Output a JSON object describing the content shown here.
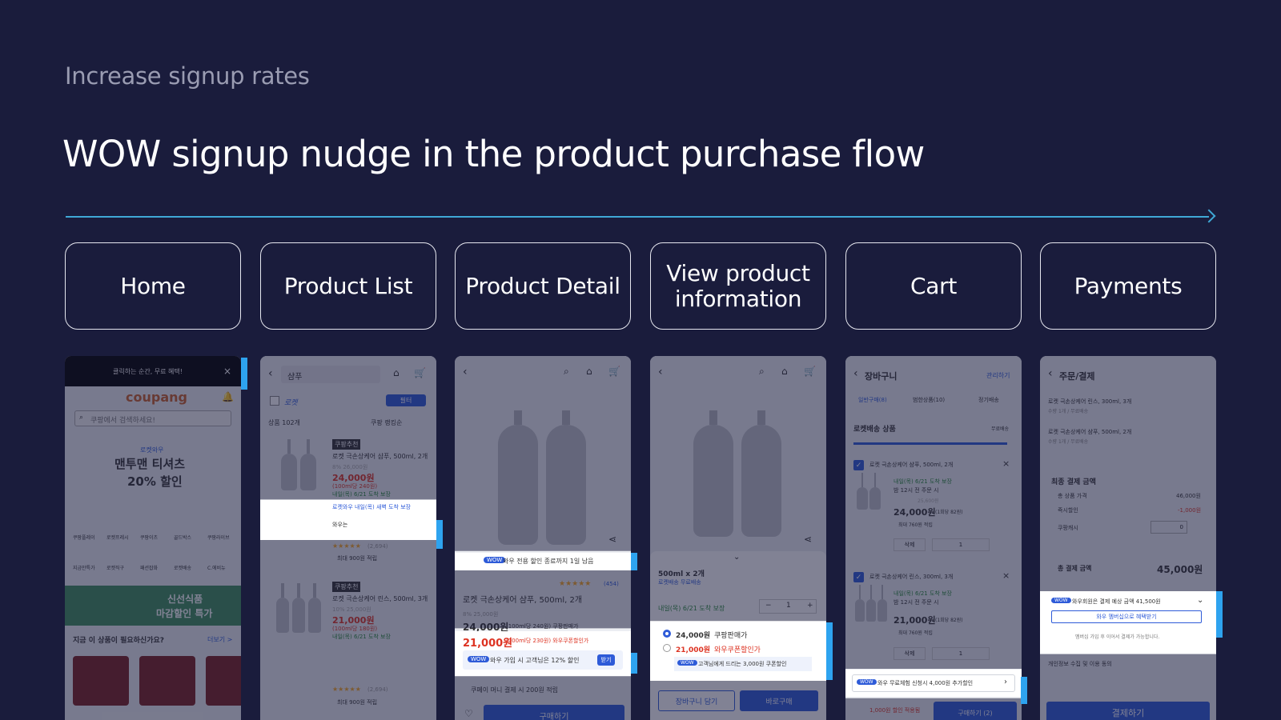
{
  "header": {
    "subtitle": "Increase signup rates",
    "title": "WOW signup nudge in the product purchase flow"
  },
  "colors": {
    "background": "#1a1c3c",
    "accent": "#3fa8d6",
    "highlight_bar": "#2ea3ef",
    "primary_button": "#2e5bd8"
  },
  "steps": [
    {
      "label": "Home"
    },
    {
      "label": "Product List"
    },
    {
      "label": "Product Detail"
    },
    {
      "label": "View product information"
    },
    {
      "label": "Cart"
    },
    {
      "label": "Payments"
    }
  ],
  "screens": {
    "home": {
      "top_banner": "클릭하는 순간, 무료 혜택!",
      "logo": "coupang",
      "search_placeholder": "쿠팡에서 검색하세요!",
      "promo_badge": "로켓와우",
      "promo_line1": "맨투맨 티셔츠",
      "promo_line2": "20% 할인",
      "categories": [
        "쿠팡플레이",
        "로켓프레시",
        "쿠팡이츠",
        "골드박스",
        "쿠팡라이브",
        "지금만특가",
        "로켓직구",
        "패션잡화",
        "로켓배송",
        "C.에비뉴"
      ],
      "fresh_banner1": "신선식품",
      "fresh_banner2": "마감할인 특가",
      "rec_title": "지금 이 상품이 필요하신가요?",
      "rec_more": "더보기 >"
    },
    "product_list": {
      "search_value": "샴푸",
      "filter_rocket": "로켓",
      "filter_button": "필터",
      "count": "상품 102개",
      "sort": "쿠팡 랭킹순",
      "item1_badge": "쿠팡추천",
      "item1_name": "로켓 극손상케어 샴푸, 500ml, 2개",
      "item1_orig": "8% 26,000원",
      "item1_price": "24,000원",
      "item1_unit": "(100ml당 240원)",
      "item1_delivery": "내일(목) 6/21 도착 보장",
      "item1_wow": "로켓와우 내일(목) 새벽 도착 보장",
      "item1_wow_sub": "와우는",
      "item1_rating": "(2,694)",
      "item1_reward": "최대 900원 적립",
      "item2_badge": "쿠팡추천",
      "item2_name": "로켓 극손상케어 린스, 500ml, 3개",
      "item2_orig": "10% 25,000원",
      "item2_price": "21,000원",
      "item2_unit": "(100ml당 180원)",
      "item2_delivery": "내일(목) 6/21 도착 보장",
      "item2_rating": "(2,694)",
      "item2_reward": "최대 900원 적립"
    },
    "product_detail": {
      "wow_strip": "와우 전용 할인 종료까지 1일 남음",
      "rating": "(454)",
      "name": "로켓 극손상케어 샴푸, 500ml, 2개",
      "orig": "8% 25,000원",
      "price": "24,000원",
      "price_note": "(100ml당 240원) 쿠팡판매가",
      "wow_price": "21,000원",
      "wow_price_note": "(100ml당 230원) 와우쿠폰할인가",
      "wow_signup": "와우 가입 시 고객님은 12% 할인",
      "wow_signup_btn": "받기",
      "coupay": "쿠페이 머니 결제 시 200원 적립",
      "buy_button": "구매하기"
    },
    "view_info": {
      "option": "500ml x 2개",
      "rocket": "로켓배송 무료배송",
      "delivery": "내일(목) 6/21 도착 보장",
      "qty": "1",
      "option_price1": "24,000원",
      "option_label1": "쿠팡판매가",
      "option_price2": "21,000원",
      "option_label2": "와우쿠폰할인가",
      "coupon_note": "고객님에게 드리는 3,000원 쿠폰할인",
      "cart_button": "장바구니 담기",
      "buy_button": "바로구매"
    },
    "cart": {
      "title": "장바구니",
      "manage": "관리하기",
      "tabs": [
        "일반구매(8)",
        "범한상품(10)",
        "정기배송"
      ],
      "section": "로켓배송 상품",
      "section_note": "무료배송",
      "item1_name": "로켓 극손상케어 샴푸, 500ml, 2개",
      "item1_delivery": "내일(목) 6/21 도착 보장",
      "item1_cutoff": "밤 12시 전 주문 시",
      "item1_orig": "25,600원",
      "item1_price": "24,000원",
      "item1_unit": "(1회당 82원)",
      "item1_reward": "최대 760원 적립",
      "item1_qty": "1",
      "item1_delete": "삭제",
      "item2_name": "로켓 극손상케어 린스, 300ml, 3개",
      "item2_delivery": "내일(목) 6/21 도착 보장",
      "item2_cutoff": "밤 12시 전 주문 시",
      "item2_price": "21,000원",
      "item2_unit": "(1회당 82원)",
      "item2_reward": "최대 760원 적립",
      "item2_qty": "1",
      "item2_delete": "삭제",
      "wow_nudge": "와우 무료체험 신청시 4,000원 추가할인",
      "bottom_discount": "1,000원 할인 적용됨",
      "bottom_button": "구매하기 (2)"
    },
    "payments": {
      "title": "주문/결제",
      "item1": "로켓 극손상케어 린스, 300ml, 3개",
      "item1_sub": "수량 1개 / 무료배송",
      "item2": "로켓 극손상케어 샴푸, 500ml, 2개",
      "item2_sub": "수량 1개 / 무료배송",
      "section": "최종 결제 금액",
      "total_label": "총 상품 가격",
      "total_value": "46,000원",
      "discount_label": "즉시할인",
      "discount_value": "-1,000원",
      "cash_label": "쿠팡캐시",
      "cash_value": "0",
      "final_label": "총 결제 금액",
      "final_value": "45,000원",
      "wow_estimate": "와우회원은 결제 예상 금액 41,500원",
      "wow_button": "와우 멤버십으로 혜택받기",
      "wow_note": "멤버십 가입 후 이어서 결제가 가능합니다.",
      "consent": "개인정보 수집 및 이용 동의",
      "pay_button": "결제하기"
    }
  }
}
